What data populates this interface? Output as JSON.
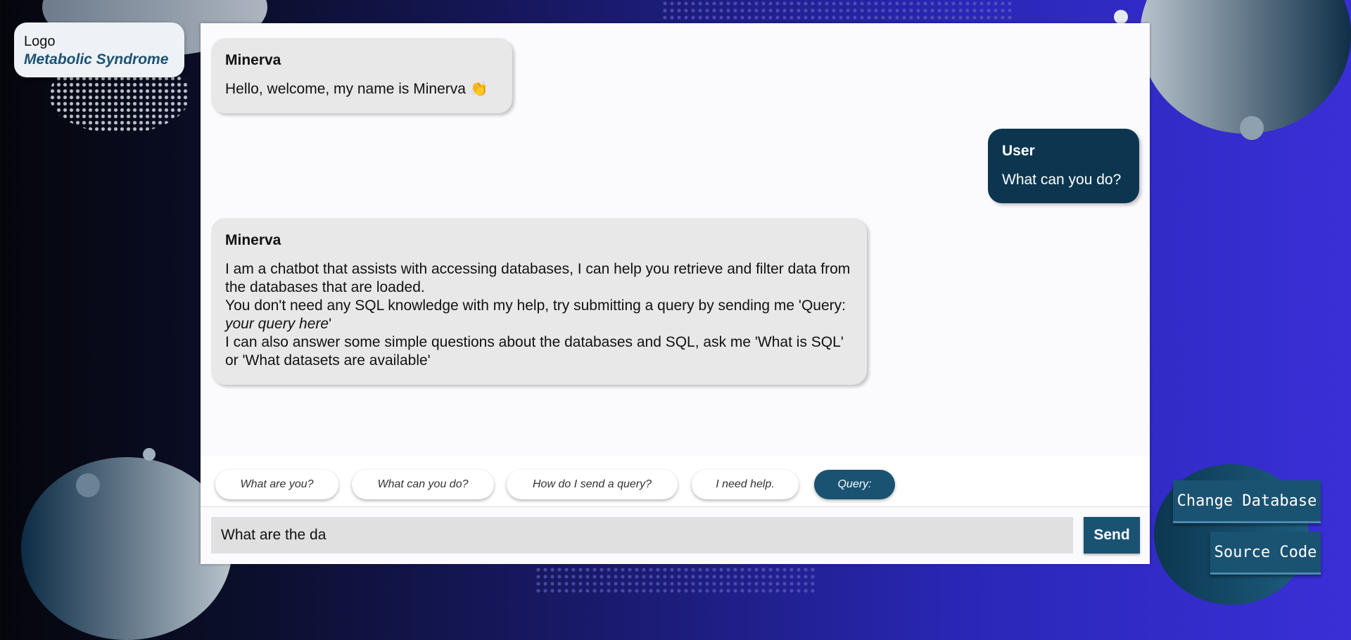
{
  "logo": {
    "text": "Logo",
    "subtitle": "Metabolic Syndrome"
  },
  "messages": [
    {
      "author": "Minerva",
      "role": "bot",
      "lines": [
        "Hello, welcome, my name is Minerva 👏"
      ]
    },
    {
      "author": "User",
      "role": "user",
      "lines": [
        "What can you do?"
      ]
    },
    {
      "author": "Minerva",
      "role": "bot",
      "lines": [
        "I am a chatbot that assists with accessing databases, I can help you retrieve and filter data from the databases that are loaded.",
        "You don't need any SQL knowledge with my help, try submitting a query by sending me 'Query: ",
        "your query here",
        "'",
        "I can also answer some simple questions about the databases and SQL, ask me 'What is SQL' or 'What datasets are available'"
      ]
    }
  ],
  "suggestions": [
    "What are you?",
    "What can you do?",
    "How do I send a query?",
    "I need help.",
    "Query:"
  ],
  "input": {
    "value": "What are the da"
  },
  "send_label": "Send",
  "side_buttons": {
    "change_database": "Change Database",
    "source_code": "Source Code"
  },
  "colors": {
    "accent": "#1a5272",
    "user_bubble": "#0c3650",
    "bot_bubble": "#e8e8e8"
  }
}
